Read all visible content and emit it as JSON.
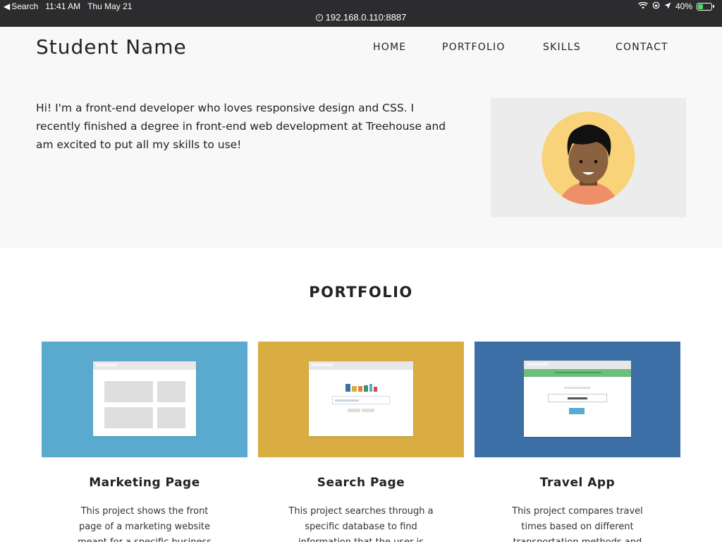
{
  "status_bar": {
    "back_label": "Search",
    "time": "11:41 AM",
    "date": "Thu May 21",
    "battery": "40%",
    "battery_level": 0.4,
    "url": "192.168.0.110:8887"
  },
  "header": {
    "site_name": "Student Name",
    "nav": [
      "HOME",
      "PORTFOLIO",
      "SKILLS",
      "CONTACT"
    ]
  },
  "hero": {
    "bio": "Hi! I'm a front-end developer who loves responsive design and CSS. I recently finished a degree in front-end web development at Treehouse and am excited to put all my skills to use!"
  },
  "portfolio": {
    "title": "PORTFOLIO",
    "items": [
      {
        "title": "Marketing Page",
        "description": "This project shows the front page of a marketing website meant for a specific business I'm interested",
        "color": "#5aa9cf"
      },
      {
        "title": "Search Page",
        "description": "This project searches through a specific database to find information that the user is trying",
        "color": "#d9ad42"
      },
      {
        "title": "Travel App",
        "description": "This project compares travel times based on different transportation methods and tells",
        "color": "#3b6fa6"
      }
    ]
  },
  "colors": {
    "status_bg": "#2c2c2e",
    "hero_bg": "#f8f8f8",
    "avatar_circle": "#f9d37a",
    "avatar_shirt": "#ef8f6a"
  }
}
